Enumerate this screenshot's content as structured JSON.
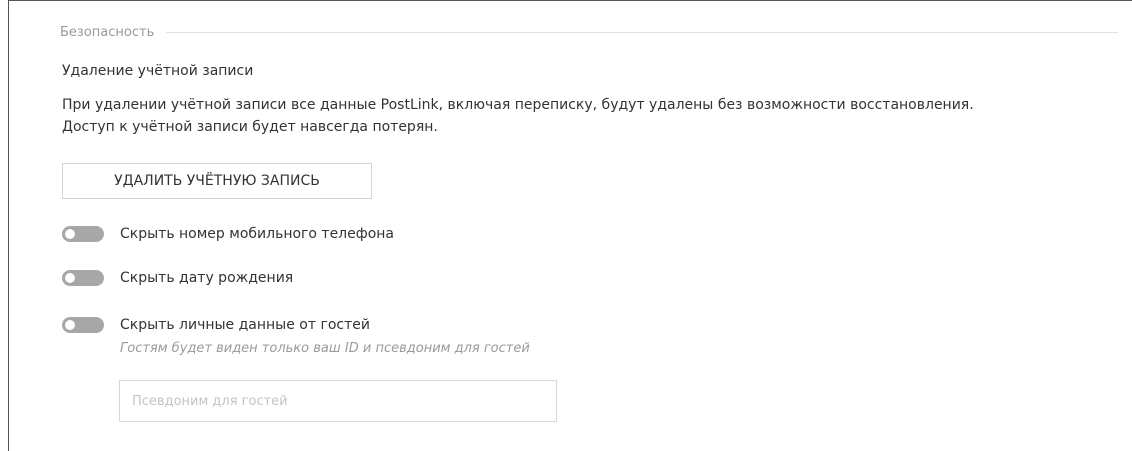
{
  "security": {
    "section_title": "Безопасность",
    "delete_account": {
      "heading": "Удаление учётной записи",
      "description_line1": "При удалении учётной записи все данные PostLink, включая переписку, будут удалены без возможности восстановления.",
      "description_line2": "Доступ к учётной записи будет навсегда потерян.",
      "button_label": "УДАЛИТЬ УЧЁТНУЮ ЗАПИСЬ"
    },
    "toggles": [
      {
        "label": "Скрыть номер мобильного телефона",
        "state": "off"
      },
      {
        "label": "Скрыть дату рождения",
        "state": "off"
      },
      {
        "label": "Скрыть личные данные от гостей",
        "state": "off"
      }
    ],
    "guest_hint": "Гостям будет виден только ваш ID и псевдоним для гостей",
    "guest_alias_input": {
      "value": "",
      "placeholder": "Псевдоним для гостей"
    }
  },
  "colors": {
    "toggle_off": "#a7a7a7",
    "muted_text": "#9a9a9a",
    "body_text": "#333333",
    "border": "#d4d4d4"
  }
}
